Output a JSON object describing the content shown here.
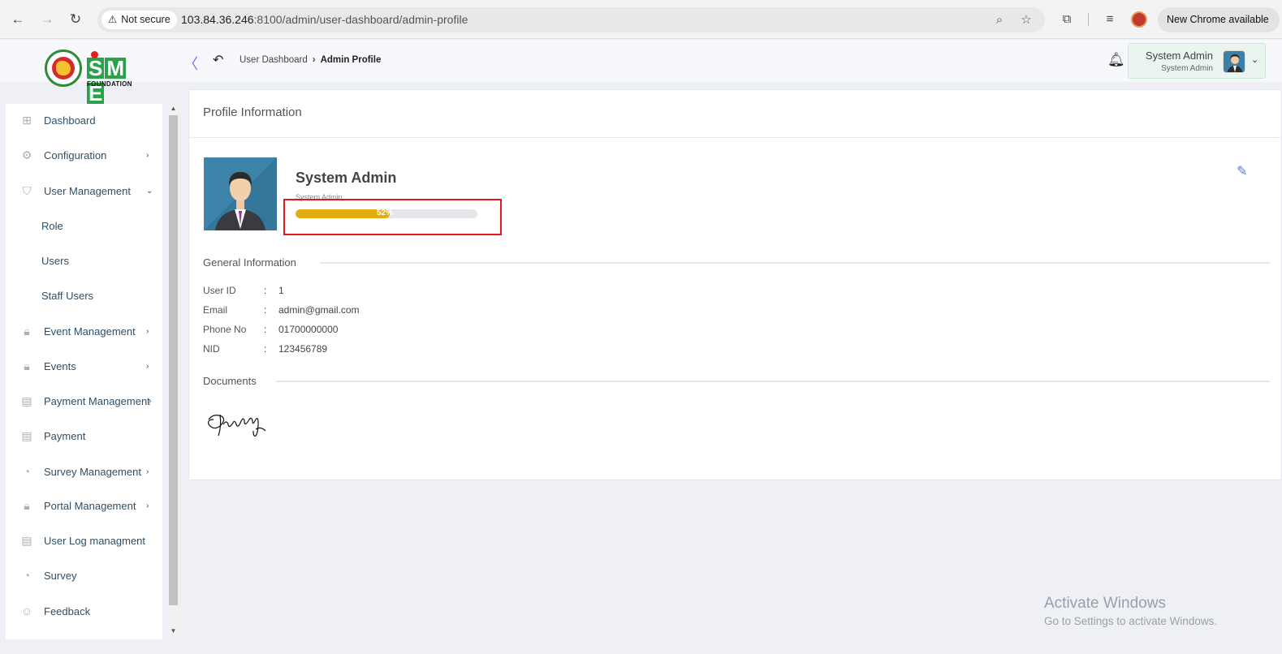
{
  "browser": {
    "security_label": "Not secure",
    "url_host": "103.84.36.246",
    "url_rest": ":8100/admin/user-dashboard/admin-profile",
    "new_chrome_label": "New Chrome available"
  },
  "header": {
    "logo_text": "SME",
    "logo_subtext": "FOUNDATION",
    "breadcrumb": [
      "User Dashboard",
      "Admin Profile"
    ],
    "user_name": "System Admin",
    "user_role": "System Admin"
  },
  "sidebar": {
    "items": [
      {
        "label": "Dashboard",
        "icon": "grid-icon",
        "caret": ""
      },
      {
        "label": "Configuration",
        "icon": "settings-icon",
        "caret": "›"
      },
      {
        "label": "User Management",
        "icon": "shield-icon",
        "caret": "⌄"
      },
      {
        "label": "Role",
        "icon": "",
        "caret": ""
      },
      {
        "label": "Users",
        "icon": "",
        "caret": ""
      },
      {
        "label": "Staff Users",
        "icon": "",
        "caret": ""
      },
      {
        "label": "Event Management",
        "icon": "lock-icon",
        "caret": "›"
      },
      {
        "label": "Events",
        "icon": "lock-icon",
        "caret": "›"
      },
      {
        "label": "Payment Management",
        "icon": "list-icon",
        "caret": "›"
      },
      {
        "label": "Payment",
        "icon": "list-icon",
        "caret": ""
      },
      {
        "label": "Survey Management",
        "icon": "pie-icon",
        "caret": "›"
      },
      {
        "label": "Portal Management",
        "icon": "lock-icon",
        "caret": "›"
      },
      {
        "label": "User Log managment",
        "icon": "list-icon",
        "caret": ""
      },
      {
        "label": "Survey",
        "icon": "pie-icon",
        "caret": ""
      },
      {
        "label": "Feedback",
        "icon": "feedback-icon",
        "caret": ""
      }
    ]
  },
  "profile": {
    "card_title": "Profile Information",
    "name": "System Admin",
    "role": "System Admin",
    "completion_label": "52%",
    "completion": 0.52
  },
  "general": {
    "title": "General Information",
    "rows": [
      {
        "key": "User ID",
        "value": "1"
      },
      {
        "key": "Email",
        "value": "admin@gmail.com"
      },
      {
        "key": "Phone No",
        "value": "01700000000"
      },
      {
        "key": "NID",
        "value": "123456789"
      }
    ]
  },
  "documents": {
    "title": "Documents"
  },
  "watermark": {
    "line1": "Activate Windows",
    "line2": "Go to Settings to activate Windows."
  },
  "colors": {
    "progress": "#e0ad12",
    "highlight": "#e3161b",
    "brand_green": "#2aa24a"
  }
}
